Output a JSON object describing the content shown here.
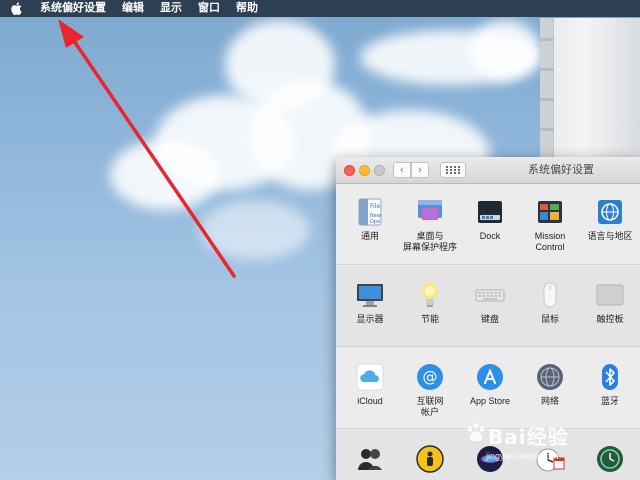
{
  "menubar": {
    "app_name": "系统偏好设置",
    "items": [
      "编辑",
      "显示",
      "窗口",
      "帮助"
    ]
  },
  "window": {
    "title": "系统偏好设置",
    "rows": [
      [
        {
          "label": "通用",
          "icon": "general-icon"
        },
        {
          "label": "桌面与\n屏幕保护程序",
          "icon": "desktop-screensaver-icon"
        },
        {
          "label": "Dock",
          "icon": "dock-icon"
        },
        {
          "label": "Mission\nControl",
          "icon": "mission-control-icon"
        },
        {
          "label": "语言与地区",
          "icon": "language-region-icon"
        }
      ],
      [
        {
          "label": "显示器",
          "icon": "displays-icon"
        },
        {
          "label": "节能",
          "icon": "energy-saver-icon"
        },
        {
          "label": "键盘",
          "icon": "keyboard-icon"
        },
        {
          "label": "鼠标",
          "icon": "mouse-icon"
        },
        {
          "label": "触控板",
          "icon": "trackpad-icon"
        }
      ],
      [
        {
          "label": "iCloud",
          "icon": "icloud-icon"
        },
        {
          "label": "互联网\n帐户",
          "icon": "internet-accounts-icon"
        },
        {
          "label": "App Store",
          "icon": "app-store-icon"
        },
        {
          "label": "网络",
          "icon": "network-icon"
        },
        {
          "label": "蓝牙",
          "icon": "bluetooth-icon"
        }
      ],
      [
        {
          "label": "",
          "icon": "users-groups-icon"
        },
        {
          "label": "",
          "icon": "parental-controls-icon"
        },
        {
          "label": "",
          "icon": "siri-icon"
        },
        {
          "label": "",
          "icon": "date-time-icon"
        },
        {
          "label": "",
          "icon": "time-machine-icon"
        }
      ]
    ]
  },
  "watermark": {
    "main": "Bai经验",
    "sub": "jingyan.baidu.com"
  },
  "colors": {
    "menubar_bg": "#2d3f52",
    "annotation_arrow": "#e8262b",
    "window_bg": "#ececec"
  }
}
